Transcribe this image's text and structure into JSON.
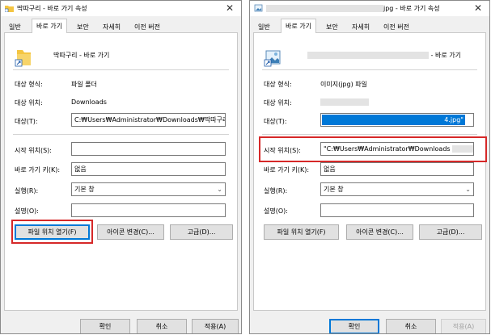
{
  "left": {
    "title": "딱따구리 - 바로 가기 속성",
    "close": "✕",
    "tabs": [
      "일반",
      "바로 가기",
      "보안",
      "자세히",
      "이전 버전"
    ],
    "name": "딱따구리 - 바로 가기",
    "target_type_label": "대상 형식:",
    "target_type_value": "파일 폴더",
    "target_location_label": "대상 위치:",
    "target_location_value": "Downloads",
    "target_label": "대상(T):",
    "target_value": "C:₩Users₩Administrator₩Downloads₩딱따구리",
    "start_in_label": "시작 위치(S):",
    "start_in_value": "",
    "shortcut_key_label": "바로 가기 키(K):",
    "shortcut_key_value": "없음",
    "run_label": "실행(R):",
    "run_value": "기본 창",
    "comment_label": "설명(O):",
    "comment_value": "",
    "open_location_btn": "파일 위치 열기(F)",
    "change_icon_btn": "아이콘 변경(C)...",
    "advanced_btn": "고급(D)...",
    "ok_btn": "확인",
    "cancel_btn": "취소",
    "apply_btn": "적용(A)"
  },
  "right": {
    "title_suffix": "jpg - 바로 가기 속성",
    "close": "✕",
    "tabs": [
      "일반",
      "바로 가기",
      "보안",
      "자세히",
      "이전 버전"
    ],
    "name_suffix": "- 바로 가기",
    "target_type_label": "대상 형식:",
    "target_type_value": "이미지(jpg) 파일",
    "target_location_label": "대상 위치:",
    "target_label": "대상(T):",
    "target_value_suffix": "4.jpg\"",
    "start_in_label": "시작 위치(S):",
    "start_in_value": "\"C:₩Users₩Administrator₩Downloads",
    "shortcut_key_label": "바로 가기 키(K):",
    "shortcut_key_value": "없음",
    "run_label": "실행(R):",
    "run_value": "기본 창",
    "comment_label": "설명(O):",
    "comment_value": "",
    "open_location_btn": "파일 위치 열기(F)",
    "change_icon_btn": "아이콘 변경(C)...",
    "advanced_btn": "고급(D)...",
    "ok_btn": "확인",
    "cancel_btn": "취소",
    "apply_btn": "적용(A)"
  },
  "icons": {
    "left_title_icon": "folder-shortcut-icon",
    "left_big_icon": "folder-shortcut-icon",
    "right_title_icon": "image-shortcut-icon",
    "right_big_icon": "image-shortcut-icon",
    "dropdown_arrow": "chevron-down-icon"
  },
  "colors": {
    "highlight": "#d62828",
    "selection": "#0078d7",
    "folder": "#f4c542"
  }
}
